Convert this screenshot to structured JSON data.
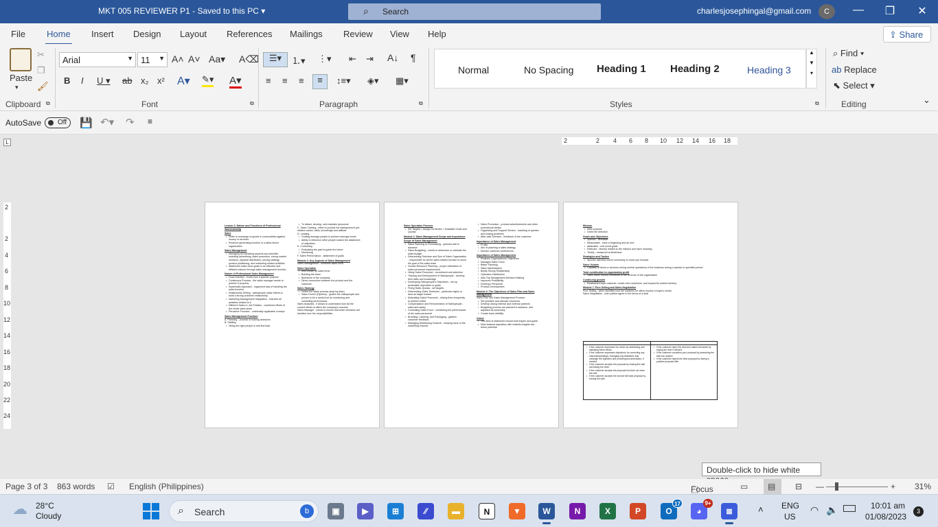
{
  "titlebar": {
    "doc_title": "MKT 005 REVIEWER P1  -  Saved to this PC",
    "search_label": "Search",
    "user_email": "charlesjosephingal@gmail.com",
    "avatar_initial": "C"
  },
  "menu_tabs": [
    "File",
    "Home",
    "Insert",
    "Design",
    "Layout",
    "References",
    "Mailings",
    "Review",
    "View",
    "Help"
  ],
  "share_label": "Share",
  "ribbon": {
    "paste_label": "Paste",
    "font_name": "Arial",
    "font_size": "11",
    "styles": [
      "Normal",
      "No Spacing",
      "Heading 1",
      "Heading 2",
      "Heading 3"
    ],
    "find_label": "Find",
    "replace_label": "Replace",
    "select_label": "Select",
    "groups": {
      "clipboard": "Clipboard",
      "font": "Font",
      "paragraph": "Paragraph",
      "styles": "Styles",
      "editing": "Editing"
    }
  },
  "qat": {
    "autosave_label": "AutoSave",
    "autosave_state": "Off"
  },
  "hruler_ticks": [
    "2",
    "2",
    "4",
    "6",
    "8",
    "10",
    "12",
    "14",
    "16",
    "18"
  ],
  "vruler_ticks": [
    "2",
    "2",
    "4",
    "6",
    "8",
    "10",
    "12",
    "14",
    "16",
    "18",
    "20",
    "22",
    "24"
  ],
  "page1": {
    "left": [
      {
        "t": "h",
        "s": "Lesson 2: Nature and Functions of Professional Salesmanship"
      },
      {
        "t": "h",
        "s": "Sales"
      },
      {
        "t": "b",
        "s": "Refer to exchange of goods or commodities against money or services"
      },
      {
        "t": "b",
        "s": "Revenue generating function in a sales-driven organization"
      },
      {
        "t": "h",
        "s": "Sales Management"
      },
      {
        "t": "b",
        "s": "Managing all marketing aspects and activities including advertising, sales promotion, strong market research, physical distribution, pricing strategy, product positioning, and marketing related activities"
      },
      {
        "t": "b",
        "s": "Attainment sales force goals in an effective and efficient manner through sales management function"
      },
      {
        "t": "h",
        "s": "Nature of Professional Sales Management"
      },
      {
        "t": "b",
        "s": "Goal-Oriented - it sets how a specific purpose"
      },
      {
        "t": "b",
        "s": "Continuous Process - the sales manager needs to perform it properly"
      },
      {
        "t": "b",
        "s": "Systematic Approach - organized way of handling the sales function"
      },
      {
        "t": "b",
        "s": "Relationship Selling - salespeople make efforts to build a strong customer relationship"
      },
      {
        "t": "b",
        "s": "Marketing Management Integration - includes all activities related to it"
      },
      {
        "t": "b",
        "s": "Different Sales or Job Position - combined efforts of the whole sales team"
      },
      {
        "t": "b",
        "s": "Pervasive Function - universally applicable concept"
      },
      {
        "t": "h",
        "s": "Sales Management Function"
      },
      {
        "t": "p",
        "s": "A. Planning - process of making decisions"
      },
      {
        "t": "p",
        "s": "B. Staffing"
      },
      {
        "t": "b",
        "s": "Hiring the right people in sell and lead"
      }
    ],
    "right": [
      {
        "t": "b",
        "s": "To attract, develop, and maintain personnel"
      },
      {
        "t": "p",
        "s": "C. Sales Training - effort to provide the salesperson's job-related culture, skills, knowledge and attitude"
      },
      {
        "t": "p",
        "s": "D. Leading"
      },
      {
        "t": "b",
        "s": "Guiding average people to perform average levels"
      },
      {
        "t": "b",
        "s": "Ability to influence other people toward the attainment of objectives"
      },
      {
        "t": "p",
        "s": "E. Controlling"
      },
      {
        "t": "b",
        "s": "Evaluating the past to guide the future"
      },
      {
        "t": "b",
        "s": "Monitoring"
      },
      {
        "t": "p",
        "s": "F. Sales Performance - attainment of goals"
      },
      {
        "t": "h",
        "s": "Module 2: Key Aspects of Sales Management"
      },
      {
        "t": "p",
        "s": "Sales management - oversees sales force"
      },
      {
        "t": "h",
        "s": "Sales Operation"
      },
      {
        "t": "b",
        "s": "Also known as sales force"
      },
      {
        "t": "b",
        "s": "Building the team"
      },
      {
        "t": "b",
        "s": "Backbone of the company"
      },
      {
        "t": "b",
        "s": "Direct connection between the product and the customer"
      },
      {
        "t": "h",
        "s": "Sales Strategy"
      },
      {
        "t": "b",
        "s": "Define the sales process (step-by-step)"
      },
      {
        "t": "b",
        "s": "Sales Funnel (Pipeline) - guides the salespeople and proves to be a useful tool for monitoring and controlling performance"
      },
      {
        "t": "p",
        "s": "Sales Analytics - it allows to understand how far the current efforts to affect the company's success"
      },
      {
        "t": "p",
        "s": "Sales Manager - needs to ensure that team members are handled over the responsibilities"
      }
    ]
  },
  "page2": {
    "left": [
      {
        "t": "h",
        "s": "Sales Operation Process"
      },
      {
        "t": "b",
        "s": "Set Targets > Assign Territories > Establish Goals and Quotas"
      },
      {
        "t": "h",
        "s": "Module 2: Sales Management Scope and Importance"
      },
      {
        "t": "h",
        "s": "Scope of Sales Management"
      },
      {
        "t": "b",
        "s": "Sales Planning or Forecasting - planned well in advance"
      },
      {
        "t": "b",
        "s": "Sales Budgeting - needs to determine or estimate the sales budget"
      },
      {
        "t": "b",
        "s": "Determining Structure and Size of Sales Organization - responsible for all the sales-related function to know the goal of the sales team"
      },
      {
        "t": "b",
        "s": "Human Resource Planning - proper estimation of sales personnel requirements"
      },
      {
        "t": "b",
        "s": "Hiring Sales Personnel - recruitment and selection"
      },
      {
        "t": "b",
        "s": "Training and Development of Salespeople - develop their skills and knowledge"
      },
      {
        "t": "b",
        "s": "Developing Salespeople's Objectives - set up achievable objectives or goals"
      },
      {
        "t": "b",
        "s": "Fixing Sales Quotas - set targets"
      },
      {
        "t": "b",
        "s": "Determining Sales Territories - particular region or area as target market"
      },
      {
        "t": "b",
        "s": "Motivating Sales Personnel - driving them frequently to perform better"
      },
      {
        "t": "b",
        "s": "Compensation and Remuneration of Salespeople - sales and salary"
      },
      {
        "t": "b",
        "s": "Controlling Sales Force - monitoring the performance of the sales personnel"
      },
      {
        "t": "b",
        "s": "Branding, Labeling, and Packaging - gathers customer feedback"
      },
      {
        "t": "b",
        "s": "Managing Distributing Channel - keeping track of the marketing channel"
      }
    ],
    "right": [
      {
        "t": "b",
        "s": "Sales Promotion - product advertisements and other promotional tactics"
      },
      {
        "t": "b",
        "s": "Organizing and Support Service - handling of queries and solving problems"
      },
      {
        "t": "b",
        "s": "After-sale Services - feedback of the customer"
      },
      {
        "t": "h",
        "s": "Importance of Sales Management"
      },
      {
        "t": "b",
        "s": "Profits"
      },
      {
        "t": "b",
        "s": "Aim of planning a sales strategy"
      },
      {
        "t": "b",
        "s": "Monitor customer preferences"
      },
      {
        "t": "h",
        "s": "Importance of Sales Management"
      },
      {
        "t": "b",
        "s": "Realizes Organizational Objectives"
      },
      {
        "t": "b",
        "s": "Manages Sales Force"
      },
      {
        "t": "b",
        "s": "Better Planning"
      },
      {
        "t": "b",
        "s": "Sales Maximization"
      },
      {
        "t": "b",
        "s": "Builds Strong Relationship"
      },
      {
        "t": "b",
        "s": "Optimizes Distribution"
      },
      {
        "t": "b",
        "s": "Aids Top Management Decision Making"
      },
      {
        "t": "b",
        "s": "Improves Profitability"
      },
      {
        "t": "b",
        "s": "Develops Personnel"
      },
      {
        "t": "b",
        "s": "Product Development"
      },
      {
        "t": "h",
        "s": "Module 6: The Objectives of Sales Plan and Sales Management"
      },
      {
        "t": "p",
        "s": "Sales Plan and Sales Management Process"
      },
      {
        "t": "b",
        "s": "Set priorities and allocate resources"
      },
      {
        "t": "b",
        "s": "Develop strong internal and external partners"
      },
      {
        "t": "b",
        "s": "Budgeting process are planned in advance, and adjusted as necessary"
      },
      {
        "t": "b",
        "s": "Create team visibility"
      },
      {
        "t": "h",
        "s": "Vision"
      },
      {
        "t": "b",
        "s": "This kind of statement should both inspire and guide"
      },
      {
        "t": "b",
        "s": "Must balance aspiration with realistic insights into future potential"
      }
    ]
  },
  "page3": {
    "lines": [
      {
        "t": "h",
        "s": "Mission"
      },
      {
        "t": "b",
        "s": "Main purpose"
      },
      {
        "t": "b",
        "s": "Gives the direction"
      },
      {
        "t": "h",
        "s": "Goals and Objectives"
      },
      {
        "t": "b",
        "s": "Specific - definable"
      },
      {
        "t": "b",
        "s": "Measurable - have a beginning and an end"
      },
      {
        "t": "b",
        "s": "Attainable - real world goals"
      },
      {
        "t": "b",
        "s": "Relevant - directly related to the mission and have meaning"
      },
      {
        "t": "b",
        "s": "Timely - measured at timeframe"
      },
      {
        "t": "h",
        "s": "Strategies and Tactics"
      },
      {
        "t": "b",
        "s": "Specific activities will be necessary to move you forward"
      },
      {
        "t": "h",
        "s": "Sales Volume"
      },
      {
        "t": "b",
        "s": "Capacity of items or services during normal operations of the business during a special or specified period"
      },
      {
        "t": "h",
        "s": "Total contribution to organization profit"
      },
      {
        "t": "b",
        "s": "Sales return should contribute to the revenue of the organization"
      },
      {
        "t": "h",
        "s": "Continuing growth"
      },
      {
        "t": "b",
        "s": "Established loyal customer, create new customers, and expand its market territory"
      },
      {
        "t": "h",
        "s": "Module 7: Pure Selling and Sales Negotiation"
      },
      {
        "t": "p",
        "s": "Pure Selling - seller identifies how the solutions he offers resolve a buyer's needs"
      },
      {
        "t": "p",
        "s": "Sales Negotiation - both parties agree to the terms of a deal"
      }
    ],
    "table_left": [
      "If the customer expresses his needs by addressing and satisfying these needs",
      "If the customer expresses objections, by correcting any misunderstandings, managing any limitations that outweigh the objection and providing documentation, if needed.",
      "If the customer accepts the proposal by closing the sale and taking the order",
      "If the customer accepts the proposal but does not close the sale",
      "If the customer accepts the second fall back proposal by closing the sale"
    ],
    "table_right": [
      "If the customer reject the deal and makes demands by buying the time if needed",
      "If the customer considers your proposal by presenting the best two options",
      "If the customer rejects the best proposal by having a position proposal offer"
    ]
  },
  "tooltip": "Double-click to hide white space",
  "status": {
    "page": "Page 3 of 3",
    "words": "863 words",
    "language": "English (Philippines)",
    "focus": "Focus",
    "zoom": "31%"
  },
  "taskbar": {
    "search_label": "Search",
    "lang_top": "ENG",
    "lang_bottom": "US",
    "time": "10:01 am",
    "date": "01/08/2023",
    "weather_temp": "28°C",
    "weather_desc": "Cloudy",
    "notif_count": "3",
    "badge_outlook": "17",
    "badge_discord": "9+"
  }
}
